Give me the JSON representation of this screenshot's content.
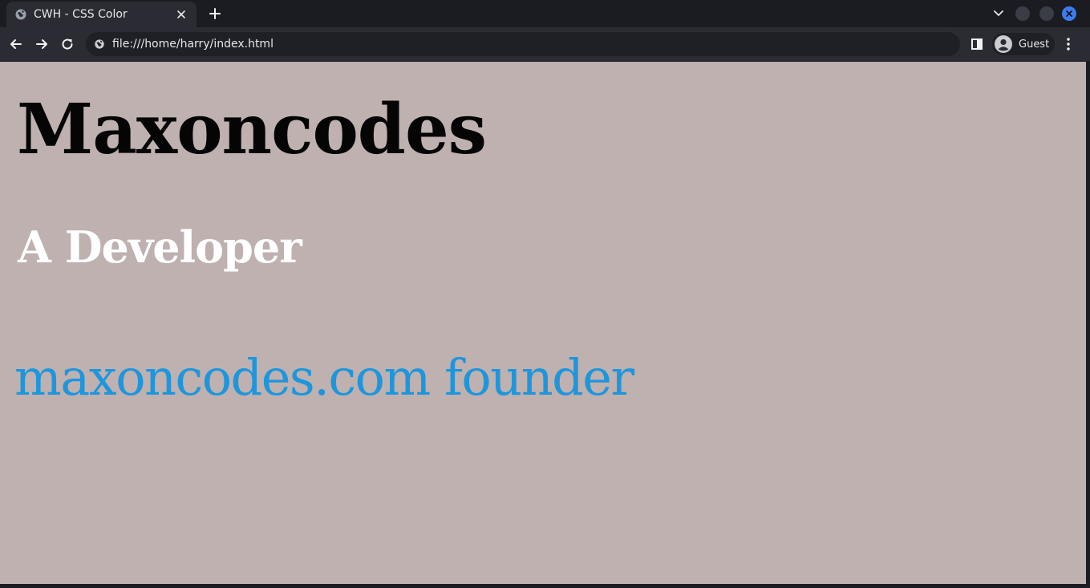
{
  "browser": {
    "tab": {
      "title": "CWH - CSS Color",
      "favicon": "globe-icon"
    },
    "omnibox": {
      "url": "file:///home/harry/index.html",
      "security_icon": "globe-icon"
    },
    "profile": {
      "label": "Guest",
      "icon": "avatar-icon"
    }
  },
  "page": {
    "heading": "Maxoncodes",
    "subheading": "A Developer",
    "tagline": "maxoncodes.com founder"
  },
  "colors": {
    "page_background": "#beb1b0",
    "heading": "#050505",
    "subheading": "#ffffff",
    "tagline": "#1e96dc",
    "window_close": "#3d7cf0"
  }
}
